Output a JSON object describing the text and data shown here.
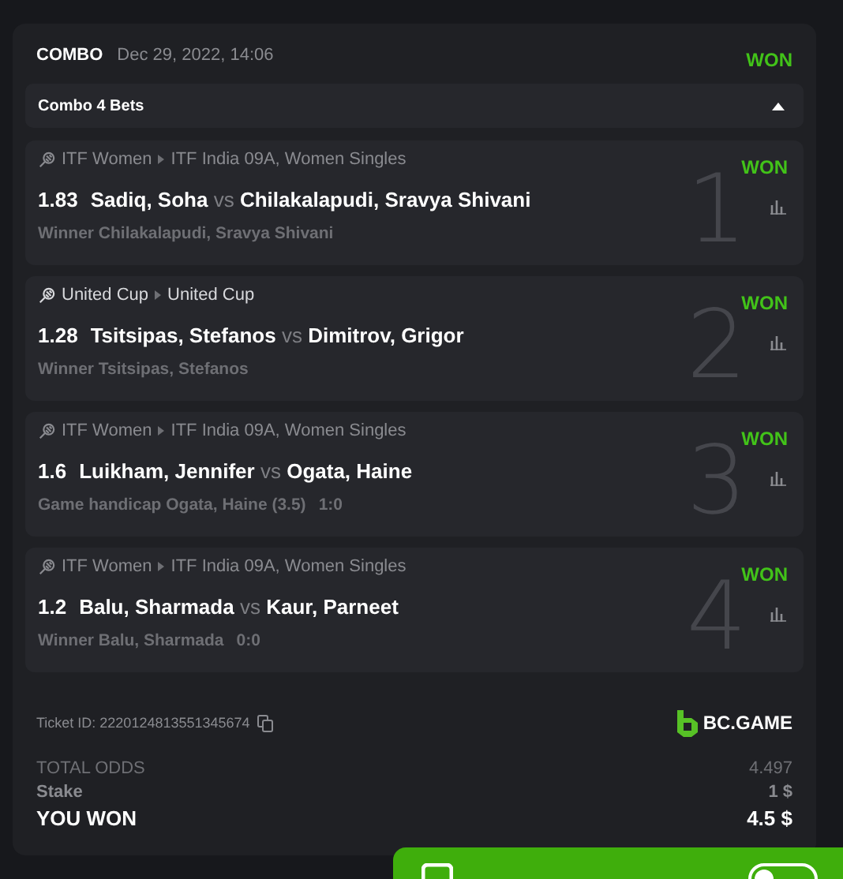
{
  "header": {
    "type": "COMBO",
    "date": "Dec 29, 2022, 14:06",
    "status": "WON"
  },
  "combo_bar": {
    "label": "Combo 4 Bets",
    "expanded": true
  },
  "bets": [
    {
      "number": "1",
      "league": "ITF Women",
      "tournament": "ITF India 09A, Women Singles",
      "status": "WON",
      "odds": "1.83",
      "home": "Sadiq, Soha",
      "vs": "vs",
      "away": "Chilakalapudi, Sravya Shivani",
      "market": "Winner Chilakalapudi, Sravya Shivani"
    },
    {
      "number": "2",
      "league": "United Cup",
      "tournament": "United Cup",
      "status": "WON",
      "odds": "1.28",
      "home": "Tsitsipas, Stefanos",
      "vs": "vs",
      "away": "Dimitrov, Grigor",
      "market": "Winner Tsitsipas, Stefanos"
    },
    {
      "number": "3",
      "league": "ITF Women",
      "tournament": "ITF India 09A, Women Singles",
      "status": "WON",
      "odds": "1.6",
      "home": "Luikham, Jennifer",
      "vs": "vs",
      "away": "Ogata, Haine",
      "market": "Game handicap Ogata, Haine (3.5)",
      "score": "1:0"
    },
    {
      "number": "4",
      "league": "ITF Women",
      "tournament": "ITF India 09A, Women Singles",
      "status": "WON",
      "odds": "1.2",
      "home": "Balu, Sharmada",
      "vs": "vs",
      "away": "Kaur, Parneet",
      "market": "Winner Balu, Sharmada",
      "score": "0:0"
    }
  ],
  "ticket": {
    "label": "Ticket ID: 2220124813551345674",
    "brand": "BC.GAME"
  },
  "totals": [
    {
      "kind": "muted",
      "label": "TOTAL ODDS",
      "value": "4.497"
    },
    {
      "kind": "sub",
      "label": "Stake",
      "value": "1 $"
    },
    {
      "kind": "main",
      "label": "YOU WON",
      "value": "4.5 $"
    }
  ],
  "details_bar": {
    "toggle_on": false
  }
}
